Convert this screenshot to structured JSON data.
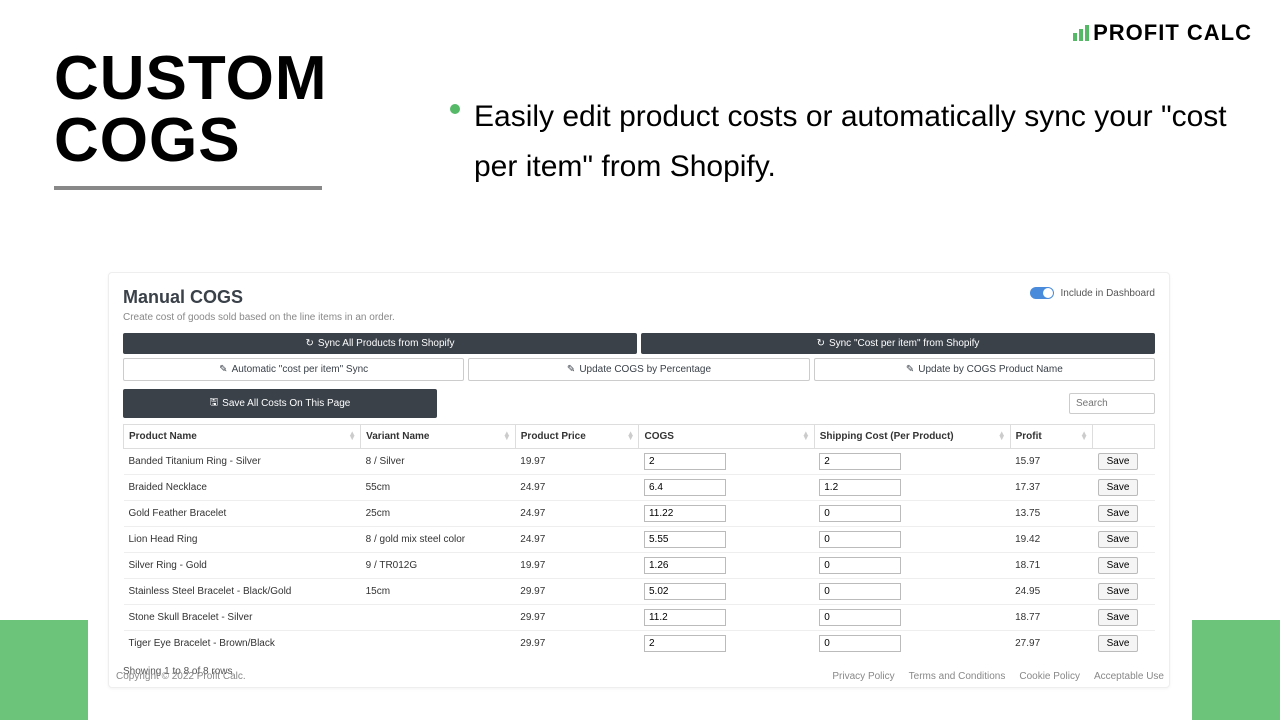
{
  "brand": {
    "name": "PROFIT CALC"
  },
  "heading": {
    "line1": "CUSTOM",
    "line2": "COGS"
  },
  "bullet": "Easily edit product costs or automatically sync your \"cost per item\" from Shopify.",
  "panel": {
    "title": "Manual COGS",
    "subtitle": "Create cost of goods sold based on the line items in an order.",
    "include_label": "Include in Dashboard",
    "buttons": {
      "sync_all": "Sync All Products from Shopify",
      "sync_cost": "Sync \"Cost per item\" from Shopify",
      "auto_sync": "Automatic \"cost per item\" Sync",
      "by_percentage": "Update COGS by Percentage",
      "by_name": "Update by COGS Product Name",
      "save_all": "Save All Costs On This Page"
    },
    "search_placeholder": "Search",
    "columns": {
      "product": "Product Name",
      "variant": "Variant Name",
      "price": "Product Price",
      "cogs": "COGS",
      "shipping": "Shipping Cost (Per Product)",
      "profit": "Profit"
    },
    "row_save": "Save",
    "rows": [
      {
        "product": "Banded Titanium Ring - Silver",
        "variant": "8 / Silver",
        "price": "19.97",
        "cogs": "2",
        "shipping": "2",
        "profit": "15.97"
      },
      {
        "product": "Braided Necklace",
        "variant": "55cm",
        "price": "24.97",
        "cogs": "6.4",
        "shipping": "1.2",
        "profit": "17.37"
      },
      {
        "product": "Gold Feather Bracelet",
        "variant": "25cm",
        "price": "24.97",
        "cogs": "11.22",
        "shipping": "0",
        "profit": "13.75"
      },
      {
        "product": "Lion Head Ring",
        "variant": "8 / gold mix steel color",
        "price": "24.97",
        "cogs": "5.55",
        "shipping": "0",
        "profit": "19.42"
      },
      {
        "product": "Silver Ring - Gold",
        "variant": "9 / TR012G",
        "price": "19.97",
        "cogs": "1.26",
        "shipping": "0",
        "profit": "18.71"
      },
      {
        "product": "Stainless Steel Bracelet - Black/Gold",
        "variant": "15cm",
        "price": "29.97",
        "cogs": "5.02",
        "shipping": "0",
        "profit": "24.95"
      },
      {
        "product": "Stone Skull Bracelet - Silver",
        "variant": "",
        "price": "29.97",
        "cogs": "11.2",
        "shipping": "0",
        "profit": "18.77"
      },
      {
        "product": "Tiger Eye Bracelet - Brown/Black",
        "variant": "",
        "price": "29.97",
        "cogs": "2",
        "shipping": "0",
        "profit": "27.97"
      }
    ],
    "table_footer": "Showing 1 to 8 of 8 rows"
  },
  "footer": {
    "copyright": "Copyright © 2022 Profit Calc.",
    "links": [
      "Privacy Policy",
      "Terms and Conditions",
      "Cookie Policy",
      "Acceptable Use"
    ]
  }
}
